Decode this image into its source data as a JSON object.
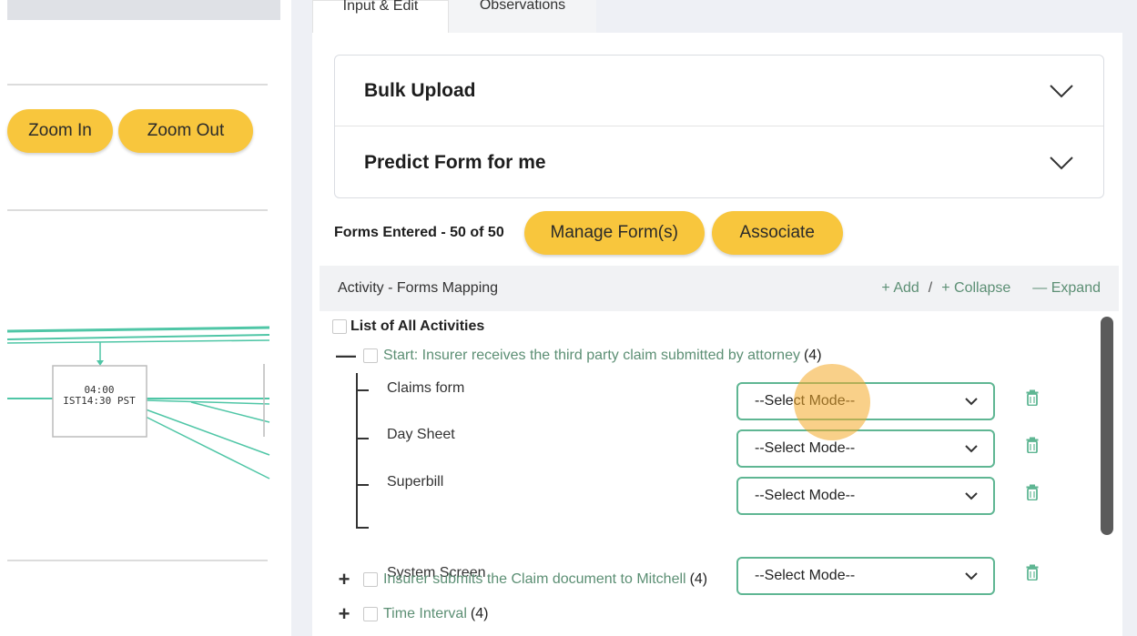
{
  "left": {
    "zoom_in_label": "Zoom In",
    "zoom_out_label": "Zoom Out",
    "node_time_line1": "04:00",
    "node_time_line2": "IST14:30 PST"
  },
  "tabs": [
    {
      "label": "Input & Edit",
      "active": true
    },
    {
      "label": "Observations",
      "active": false
    }
  ],
  "accordion": [
    {
      "title": "Bulk Upload",
      "icon": "chevron-down-icon"
    },
    {
      "title": "Predict Form for me",
      "icon": "chevron-down-icon"
    }
  ],
  "forms": {
    "entered_label": "Forms Entered - 50 of 50",
    "manage_label": "Manage Form(s)",
    "associate_label": "Associate"
  },
  "mapping": {
    "title": "Activity - Forms Mapping",
    "add_label": "+ Add",
    "separator": "/",
    "collapse_label": "+ Collapse",
    "expand_label": "— Expand"
  },
  "tree": {
    "root_label": "List of All Activities",
    "activities": [
      {
        "toggle": "—",
        "label": "Start: Insurer receives the third party claim submitted by attorney",
        "count": "(4)",
        "expanded": true
      },
      {
        "toggle": "+",
        "label": "Insurer submits the Claim document to Mitchell",
        "count": "(4)",
        "expanded": false
      },
      {
        "toggle": "+",
        "label": "Time Interval",
        "count": "(4)",
        "expanded": false
      }
    ],
    "forms": [
      {
        "name": "Claims form",
        "mode": "--Select Mode--"
      },
      {
        "name": "Day Sheet",
        "mode": "--Select Mode--"
      },
      {
        "name": "Superbill",
        "mode": "--Select Mode--"
      },
      {
        "name": "System Screen",
        "mode": "--Select Mode--"
      }
    ]
  },
  "colors": {
    "accent_yellow": "#f8c63d",
    "link_green": "#5c8f74",
    "select_border": "#5fb693",
    "graph_line": "#4fc6a6"
  }
}
